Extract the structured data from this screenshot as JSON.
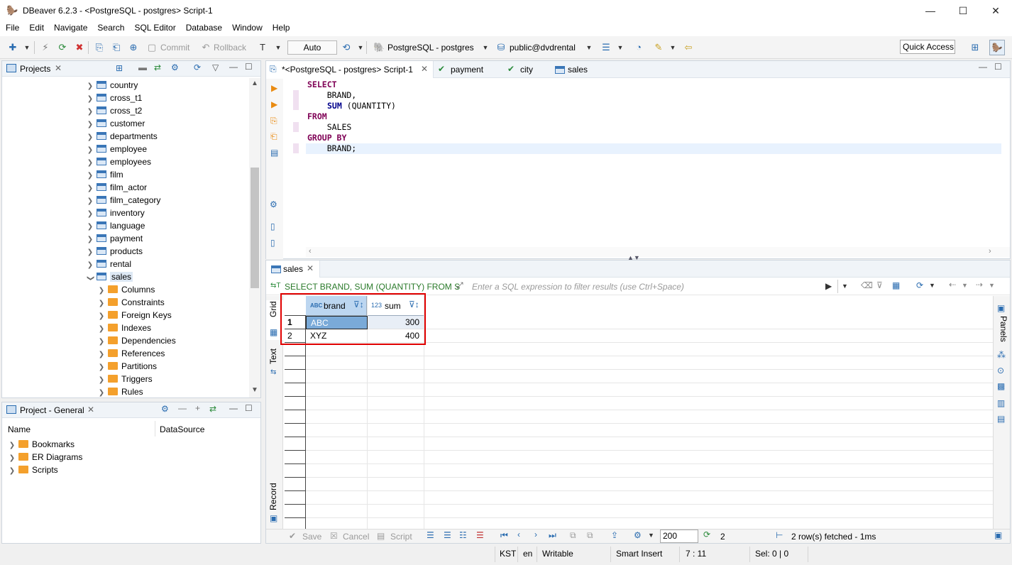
{
  "window": {
    "title": "DBeaver 6.2.3 - <PostgreSQL - postgres> Script-1",
    "minimize": "—",
    "maximize": "☐",
    "close": "✕"
  },
  "menu": [
    "File",
    "Edit",
    "Navigate",
    "Search",
    "SQL Editor",
    "Database",
    "Window",
    "Help"
  ],
  "toolbar": {
    "commit": "Commit",
    "rollback": "Rollback",
    "tx_mode": "Auto",
    "connection": "PostgreSQL - postgres",
    "schema": "public@dvdrental",
    "quick_access": "Quick Access"
  },
  "projects_panel": {
    "title": "Projects",
    "tables": [
      "country",
      "cross_t1",
      "cross_t2",
      "customer",
      "departments",
      "employee",
      "employees",
      "film",
      "film_actor",
      "film_category",
      "inventory",
      "language",
      "payment",
      "products",
      "rental",
      "sales"
    ],
    "sales_children": [
      "Columns",
      "Constraints",
      "Foreign Keys",
      "Indexes",
      "Dependencies",
      "References",
      "Partitions",
      "Triggers",
      "Rules"
    ]
  },
  "project_general": {
    "title": "Project - General",
    "col_name": "Name",
    "col_datasource": "DataSource",
    "items": [
      "Bookmarks",
      "ER Diagrams",
      "Scripts"
    ]
  },
  "editor_tabs": [
    {
      "label": "*<PostgreSQL - postgres> Script-1",
      "active": true
    },
    {
      "label": "payment"
    },
    {
      "label": "city"
    },
    {
      "label": "sales"
    }
  ],
  "sql": {
    "line1": "SELECT",
    "line2": "    BRAND,",
    "line3_fn": "SUM",
    "line3_rest": " (QUANTITY)",
    "line4": "FROM",
    "line5": "    SALES",
    "line6": "GROUP BY",
    "line7": "    BRAND;"
  },
  "results": {
    "tab": "sales",
    "query_preview": "SELECT BRAND, SUM (QUANTITY) FROM S",
    "filter_placeholder": "Enter a SQL expression to filter results (use Ctrl+Space)",
    "side_tabs": [
      "Grid",
      "Text",
      "Record"
    ],
    "right_label": "Panels",
    "columns": [
      {
        "type": "ABC",
        "name": "brand"
      },
      {
        "type": "123",
        "name": "sum"
      }
    ],
    "rows": [
      [
        "1",
        "ABC",
        "300"
      ],
      [
        "2",
        "XYZ",
        "400"
      ]
    ]
  },
  "result_footer": {
    "save": "Save",
    "cancel": "Cancel",
    "script": "Script",
    "fetch_size": "200",
    "refresh_count": "2",
    "fetched": "2 row(s) fetched - 1ms"
  },
  "statusbar": {
    "tz": "KST",
    "lang": "en",
    "mode": "Writable",
    "insert": "Smart Insert",
    "pos": "7 : 11",
    "sel": "Sel: 0 | 0"
  },
  "colors": {
    "accent": "#2a6cb0",
    "highlight_box": "#e00000",
    "selected_cell": "#7aaad8",
    "keyword": "#7f0055"
  }
}
